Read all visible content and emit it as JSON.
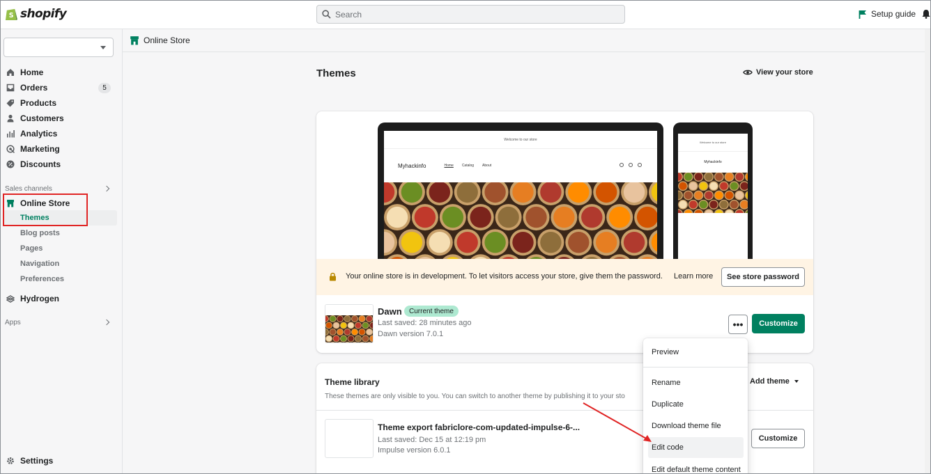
{
  "header": {
    "logo_text": "shopify",
    "search_placeholder": "Search",
    "setup_guide": "Setup guide"
  },
  "sidebar": {
    "store_selector_value": "",
    "items": [
      {
        "label": "Home",
        "icon": "home-icon"
      },
      {
        "label": "Orders",
        "icon": "orders-icon",
        "badge": "5"
      },
      {
        "label": "Products",
        "icon": "tag-icon"
      },
      {
        "label": "Customers",
        "icon": "person-icon"
      },
      {
        "label": "Analytics",
        "icon": "bar-chart-icon"
      },
      {
        "label": "Marketing",
        "icon": "target-icon"
      },
      {
        "label": "Discounts",
        "icon": "discount-icon"
      }
    ],
    "sales_channels_label": "Sales channels",
    "online_store_label": "Online Store",
    "sub_items": [
      "Themes",
      "Blog posts",
      "Pages",
      "Navigation",
      "Preferences"
    ],
    "hydrogen_label": "Hydrogen",
    "apps_label": "Apps",
    "settings_label": "Settings"
  },
  "breadcrumb": {
    "label": "Online Store"
  },
  "main": {
    "title": "Themes",
    "view_store": "View your store",
    "preview": {
      "announcement": "Welcome to our store",
      "brand": "Myhackinfo",
      "nav_links": [
        "Home",
        "Catalog",
        "About"
      ]
    },
    "dev_banner": {
      "text": "Your online store is in development. To let visitors access your store, give them the password.",
      "learn_more": "Learn more",
      "button": "See store password"
    },
    "current_theme": {
      "name": "Dawn",
      "badge": "Current theme",
      "last_saved": "Last saved: 28 minutes ago",
      "version": "Dawn version 7.0.1",
      "more_button": "•••",
      "customize": "Customize"
    },
    "library": {
      "title": "Theme library",
      "subtitle": "These themes are only visible to you. You can switch to another theme by publishing it to your sto",
      "add_theme": "Add theme",
      "theme": {
        "name": "Theme export fabriclore-com-updated-impulse-6-...",
        "last_saved": "Last saved: Dec 15 at 12:19 pm",
        "version": "Impulse version 6.0.1",
        "customize": "Customize"
      }
    }
  },
  "action_menu": {
    "items": [
      "Preview",
      "Rename",
      "Duplicate",
      "Download theme file",
      "Edit code",
      "Edit default theme content"
    ]
  },
  "colors": {
    "primary_green": "#008060",
    "badge_green": "#aee9d1",
    "banner_bg": "#fff4e4",
    "annotation_red": "#e02424"
  }
}
